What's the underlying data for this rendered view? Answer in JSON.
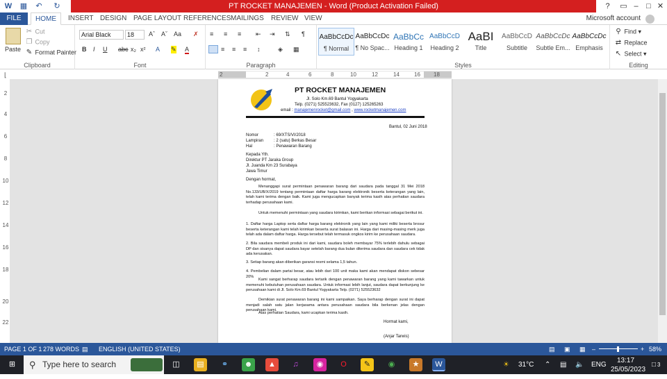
{
  "window": {
    "title": "PT ROCKET MANAJEMEN  -  Word (Product Activation Failed)",
    "account": "Microsoft account"
  },
  "quick_access": {
    "save": "💾",
    "undo": "↶",
    "redo": "↻"
  },
  "tabs": [
    "FILE",
    "HOME",
    "INSERT",
    "DESIGN",
    "PAGE LAYOUT",
    "REFERENCES",
    "MAILINGS",
    "REVIEW",
    "VIEW"
  ],
  "ribbon": {
    "clipboard": {
      "label": "Clipboard",
      "paste": "Paste",
      "cut": "Cut",
      "copy": "Copy",
      "format_painter": "Format Painter"
    },
    "font": {
      "label": "Font",
      "font_name": "Arial Black",
      "font_size": "18"
    },
    "paragraph": {
      "label": "Paragraph"
    },
    "styles": {
      "label": "Styles",
      "items": [
        {
          "sample": "AaBbCcDc",
          "name": "¶ Normal"
        },
        {
          "sample": "AaBbCcDc",
          "name": "¶ No Spac..."
        },
        {
          "sample": "AaBbCc",
          "name": "Heading 1"
        },
        {
          "sample": "AaBbCcD",
          "name": "Heading 2"
        },
        {
          "sample": "AaBI",
          "name": "Title"
        },
        {
          "sample": "AaBbCcD",
          "name": "Subtitle"
        },
        {
          "sample": "AaBbCcDc",
          "name": "Subtle Em..."
        },
        {
          "sample": "AaBbCcDc",
          "name": "Emphasis"
        }
      ]
    },
    "editing": {
      "label": "Editing",
      "find": "Find",
      "replace": "Replace",
      "select": "Select"
    }
  },
  "ruler": {
    "h_numbers": [
      "2",
      "2",
      "4",
      "6",
      "8",
      "10",
      "12",
      "14",
      "16",
      "18"
    ],
    "v_numbers": [
      "2",
      "4",
      "6",
      "8",
      "10",
      "12",
      "14",
      "16",
      "18",
      "20",
      "22"
    ]
  },
  "letter": {
    "company": "PT ROCKET MANAJEMEN",
    "address": "Jl. Solo Km.69 Bantul Yogyakarta",
    "phone": "Telp. (0271) 525523632, Fax (0127) 125265263",
    "email_prefix": "email : ",
    "email": "manajemenrocket@gmail.com",
    "web": "www.rocketmanajemen.com",
    "date": "Bantul, 02 Juni 2018",
    "nomor_label": "Nomor",
    "nomor": ": 69/XTS/VI/2018",
    "lampiran_label": "Lampiran",
    "lampiran": ": 2 (satu) Berkas Besar",
    "hal_label": "Hal",
    "hal": ": Penawaran Barang",
    "to1": "Kepada Yth.",
    "to2": "Direktur PT Jaraka Group",
    "to3": "Jl. Juanda Km 23 Surabaya",
    "to4": "Jawa Timur",
    "greet": "Dengan hormat,",
    "p1": "Menanggapi surat permintaan penawaran barang dari saudara pada tanggal 31 Mei 2018 No.133/UB/X/2019 tentang permintaan daftar harga barang elektronik beserta keterangan yang lain, telah kami terima dengan baik. Kami juga mengucapkan banyak terima kasih atas perhatian saudara terhadap perusahaan kami.",
    "p2": "Untuk memenuhi permintaan yang saudara kirimkan, kami berikan informasi sebagai berikut ini.",
    "p3": "1. Daftar harga Laptop serta daftar harga barang elektronik yang lain yang kami miliki beserta brosur beserta keterangan kami telah kirimkan beserta surat balasan ini. Harga dari masing-masing merk juga telah ada dalam daftar harga. Harga tersebut telah termasuk ongkos kirim ke perusahaan saudara.",
    "p4": "2. Bila saudara membeli produk ini dari kami, saudara boleh membayar 75% terlebih dahulu sebagai DP dan sisanya dapat saudara bayar setelah barang dua bulan diterima saudara dan saudara cek tidak ada kerusakan.",
    "p5": "3. Setiap barang akan diberikan garansi resmi selama 1,5 tahun.",
    "p6": "4. Pembelian dalam partai besar, atau lebih dari 100 unit maka kami akan mendapat diskon sebesar 20%",
    "p7": "Kami sangat berharap saudara tertarik dengan penawaran barang yang kami tawarkan untuk memenuhi kebutuhan perusahaan saudara. Untuk informasi lebih lanjut, saudara dapat berkunjung ke perusahaan kami di Jl. Solo Km.69 Bantul Yogyakarta Telp. (0271) 525523632",
    "p8": "Demikian surat penawaran barang ini kami sampaikan. Saya berharap dengan surat ini dapat menjadi salah satu jalan kerjasama antara perusahaan saudara bila berkenan jelas dengan perusahaan kami.",
    "p9": "Atas perhatian Saudara, kami ucapkan terima kasih.",
    "closing": "Hormat kami,",
    "signer": "(Anjar Tarwis)"
  },
  "status": {
    "page": "PAGE 1 OF 1",
    "words": "278 WORDS",
    "language": "ENGLISH (UNITED STATES)",
    "zoom": "58%"
  },
  "taskbar": {
    "search_placeholder": "Type here to search",
    "weather": "31°C",
    "lang": "ENG",
    "time": "13:17",
    "date": "25/05/2023",
    "notif_count": "3"
  }
}
